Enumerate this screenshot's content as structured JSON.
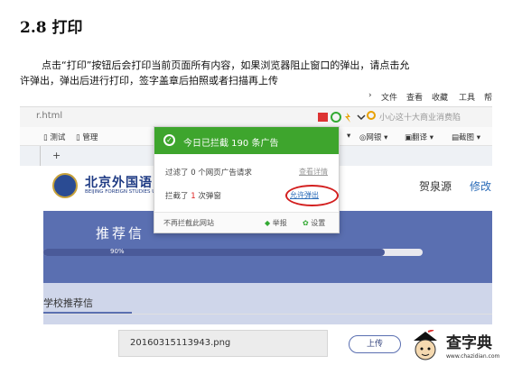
{
  "section_heading": "2.8 打印",
  "paragraph": {
    "line1": "点击“打印”按钮后会打印当前页面所有内容，如果浏览器阻止窗口的弹出，请点击允",
    "line2": "许弹出，弹出后进行打印，签字盖章后拍照或者扫描再上传"
  },
  "browser": {
    "menu": [
      "文件",
      "查看",
      "收藏",
      "工具",
      "帮"
    ],
    "url": "r.html",
    "search_hint": "小心这十大商业消费陷",
    "bookmarks": [
      "测试",
      "管理"
    ],
    "toolbar_items": [
      "网银",
      "翻译",
      "截图"
    ],
    "new_tab": "+"
  },
  "site": {
    "logo_cn": "北京外国语",
    "logo_en": "BEIJING FOREIGN STUDIES U",
    "user_name": "贺泉源",
    "modify_link": "修改",
    "banner_title": "推荐信",
    "progress_label": "90%",
    "progress_value": 0.9,
    "section_label": "学校推荐信",
    "file_name": "20160315113943.png",
    "upload_button": "上传"
  },
  "popup": {
    "header": "今日已拦截  190 条广告",
    "filtered_text": "过滤了 0 个网页广告请求",
    "view_details": "查看详情",
    "blocked_prefix": "拦截了 ",
    "blocked_count": "1",
    "blocked_suffix": " 次弹窗",
    "allow_popup": "允许弹出",
    "no_block_site": "不再拦截此网站",
    "report": "举报",
    "settings": "设置"
  },
  "watermark": {
    "brand": "查字典",
    "url": "www.chazidian.com"
  },
  "colors": {
    "popup_green": "#3ea52d",
    "banner_blue": "#5a6fb1",
    "highlight_red": "#d31f1f"
  }
}
